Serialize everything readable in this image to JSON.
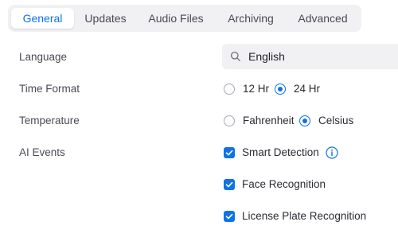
{
  "tabs": [
    {
      "label": "General",
      "active": true
    },
    {
      "label": "Updates",
      "active": false
    },
    {
      "label": "Audio Files",
      "active": false
    },
    {
      "label": "Archiving",
      "active": false
    },
    {
      "label": "Advanced",
      "active": false
    }
  ],
  "settings": {
    "language": {
      "label": "Language",
      "value": "English",
      "icon": "search-icon"
    },
    "time_format": {
      "label": "Time Format",
      "options": [
        {
          "label": "12 Hr",
          "selected": false
        },
        {
          "label": "24 Hr",
          "selected": true
        }
      ]
    },
    "temperature": {
      "label": "Temperature",
      "options": [
        {
          "label": "Fahrenheit",
          "selected": false
        },
        {
          "label": "Celsius",
          "selected": true
        }
      ]
    },
    "ai_events": {
      "label": "AI Events",
      "options": [
        {
          "label": "Smart Detection",
          "checked": true,
          "info_icon": "info-icon"
        },
        {
          "label": "Face Recognition",
          "checked": true
        },
        {
          "label": "License Plate Recognition",
          "checked": true
        }
      ]
    }
  },
  "colors": {
    "accent": "#0e72ed",
    "tab_bar_bg": "#f1f1f4",
    "label_text": "#4a4a55"
  }
}
